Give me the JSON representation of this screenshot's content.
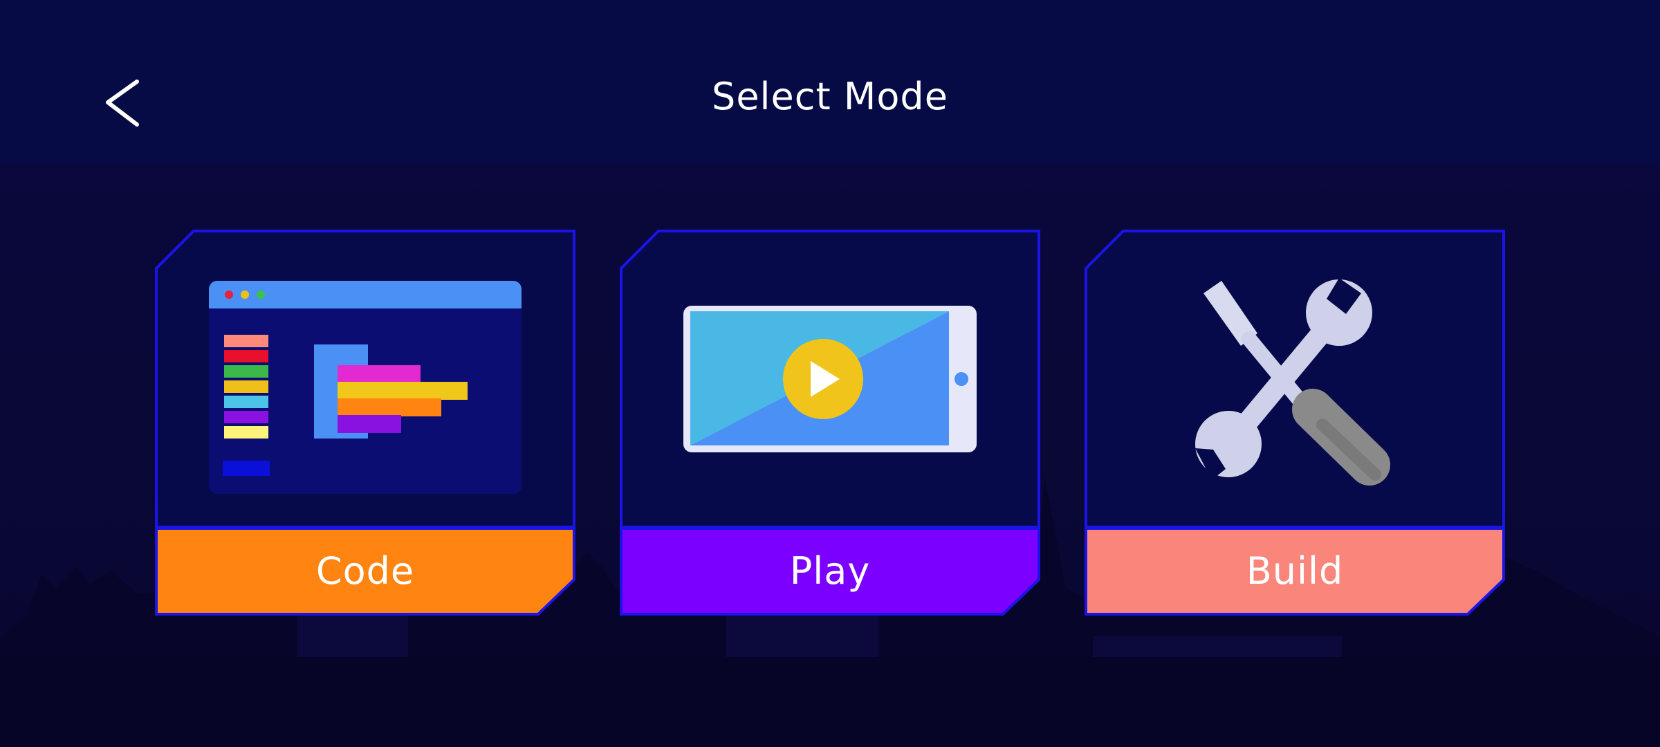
{
  "header": {
    "title": "Select Mode",
    "back_icon": "chevron-left-icon"
  },
  "modes": [
    {
      "label": "Code",
      "color": "#ff8412",
      "icon": "code-editor-icon"
    },
    {
      "label": "Play",
      "color": "#7b00ff",
      "icon": "tablet-video-play-icon"
    },
    {
      "label": "Build",
      "color": "#fa857b",
      "icon": "tools-wrench-screwdriver-icon"
    }
  ],
  "colors": {
    "header_bg": "#060b45",
    "page_bg": "#0a0836",
    "card_border": "#1a14e6",
    "card_bg": "#070a4a"
  }
}
